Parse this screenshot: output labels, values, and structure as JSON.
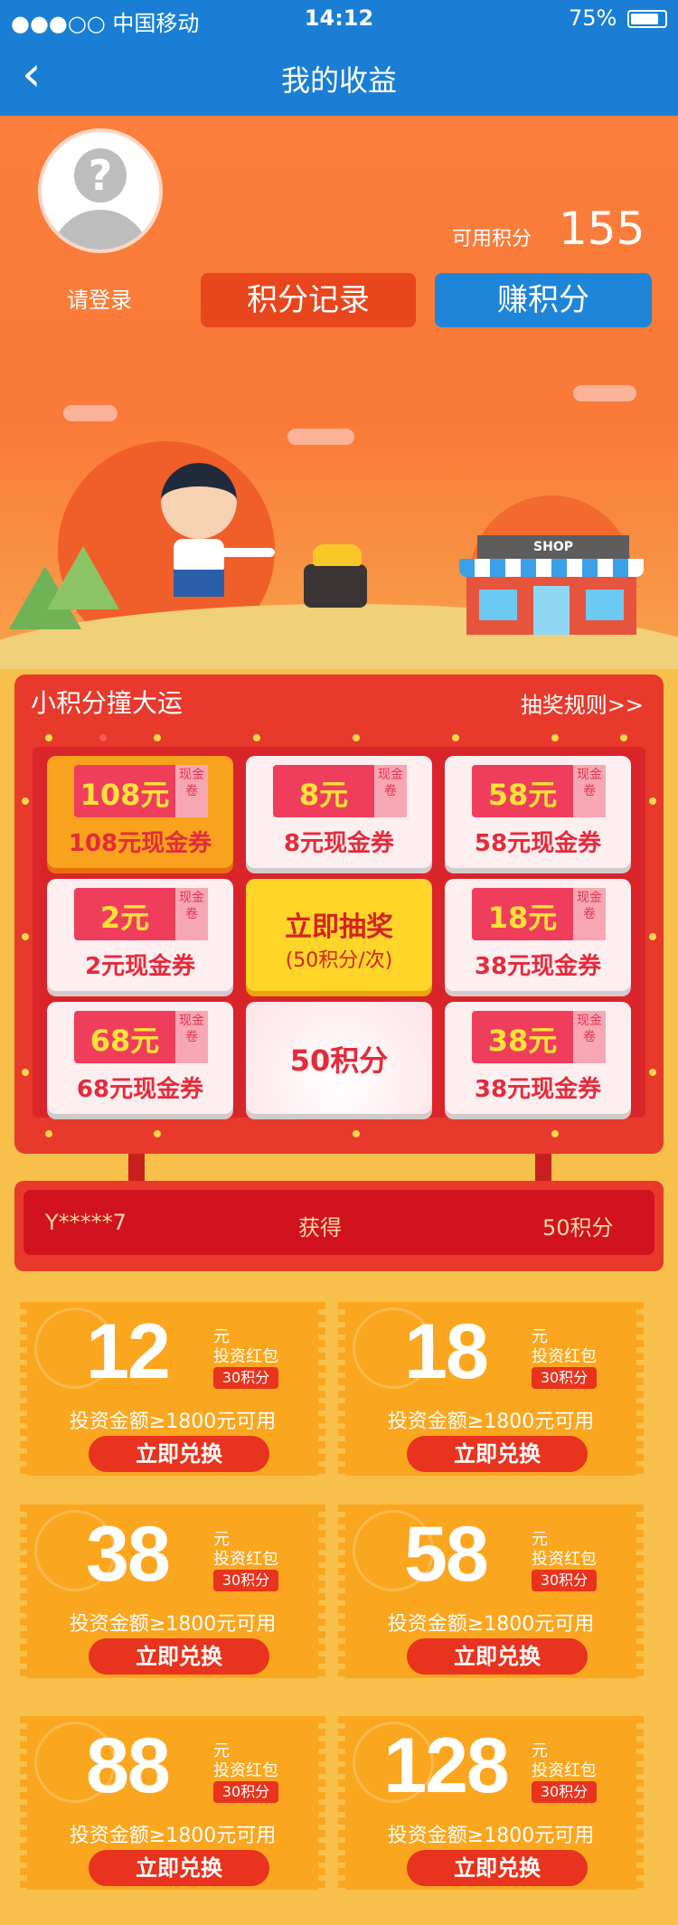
{
  "status_bar": {
    "carrier": "●●●○○ 中国移动",
    "time": "14:12",
    "battery": "75%"
  },
  "nav": {
    "back_glyph": "‹",
    "title": "我的收益"
  },
  "profile": {
    "login_text": "请登录",
    "points_label": "可用积分",
    "points_value": "155"
  },
  "actions": {
    "record_label": "积分记录",
    "earn_label": "赚积分"
  },
  "scene": {
    "shop_sign": "SHOP"
  },
  "lottery": {
    "title": "小积分撞大运",
    "rules_link": "抽奖规则>>",
    "tag_text": "现金卷",
    "cells": [
      {
        "amount": "108元",
        "label": "108元现金券"
      },
      {
        "amount": "8元",
        "label": "8元现金券"
      },
      {
        "amount": "58元",
        "label": "58元现金券"
      },
      {
        "amount": "2元",
        "label": "2元现金券"
      },
      {
        "amount": "18元",
        "label": "38元现金券"
      },
      {
        "amount": "68元",
        "label": "68元现金券"
      },
      {
        "amount": "38元",
        "label": "38元现金券"
      }
    ],
    "draw_button": {
      "title": "立即抽奖",
      "subtitle": "(50积分/次)"
    },
    "points_cell": "50积分"
  },
  "winner": {
    "user": "Y*****7",
    "action": "获得",
    "prize": "50积分"
  },
  "coupons": [
    {
      "value": "12",
      "unit": "元",
      "kind": "投资红包",
      "cost": "30积分",
      "condition": "投资金额≥1800元可用",
      "button": "立即兑换"
    },
    {
      "value": "18",
      "unit": "元",
      "kind": "投资红包",
      "cost": "30积分",
      "condition": "投资金额≥1800元可用",
      "button": "立即兑换"
    },
    {
      "value": "38",
      "unit": "元",
      "kind": "投资红包",
      "cost": "30积分",
      "condition": "投资金额≥1800元可用",
      "button": "立即兑换"
    },
    {
      "value": "58",
      "unit": "元",
      "kind": "投资红包",
      "cost": "30积分",
      "condition": "投资金额≥1800元可用",
      "button": "立即兑换"
    },
    {
      "value": "88",
      "unit": "元",
      "kind": "投资红包",
      "cost": "30积分",
      "condition": "投资金额≥1800元可用",
      "button": "立即兑换"
    },
    {
      "value": "128",
      "unit": "元",
      "kind": "投资红包",
      "cost": "30积分",
      "condition": "投资金额≥1800元可用",
      "button": "立即兑换"
    }
  ],
  "colors": {
    "nav_blue": "#1a7fd4",
    "hero_orange": "#fb7e3b",
    "board_red": "#e73a2c",
    "coupon_orange": "#fba61f"
  }
}
